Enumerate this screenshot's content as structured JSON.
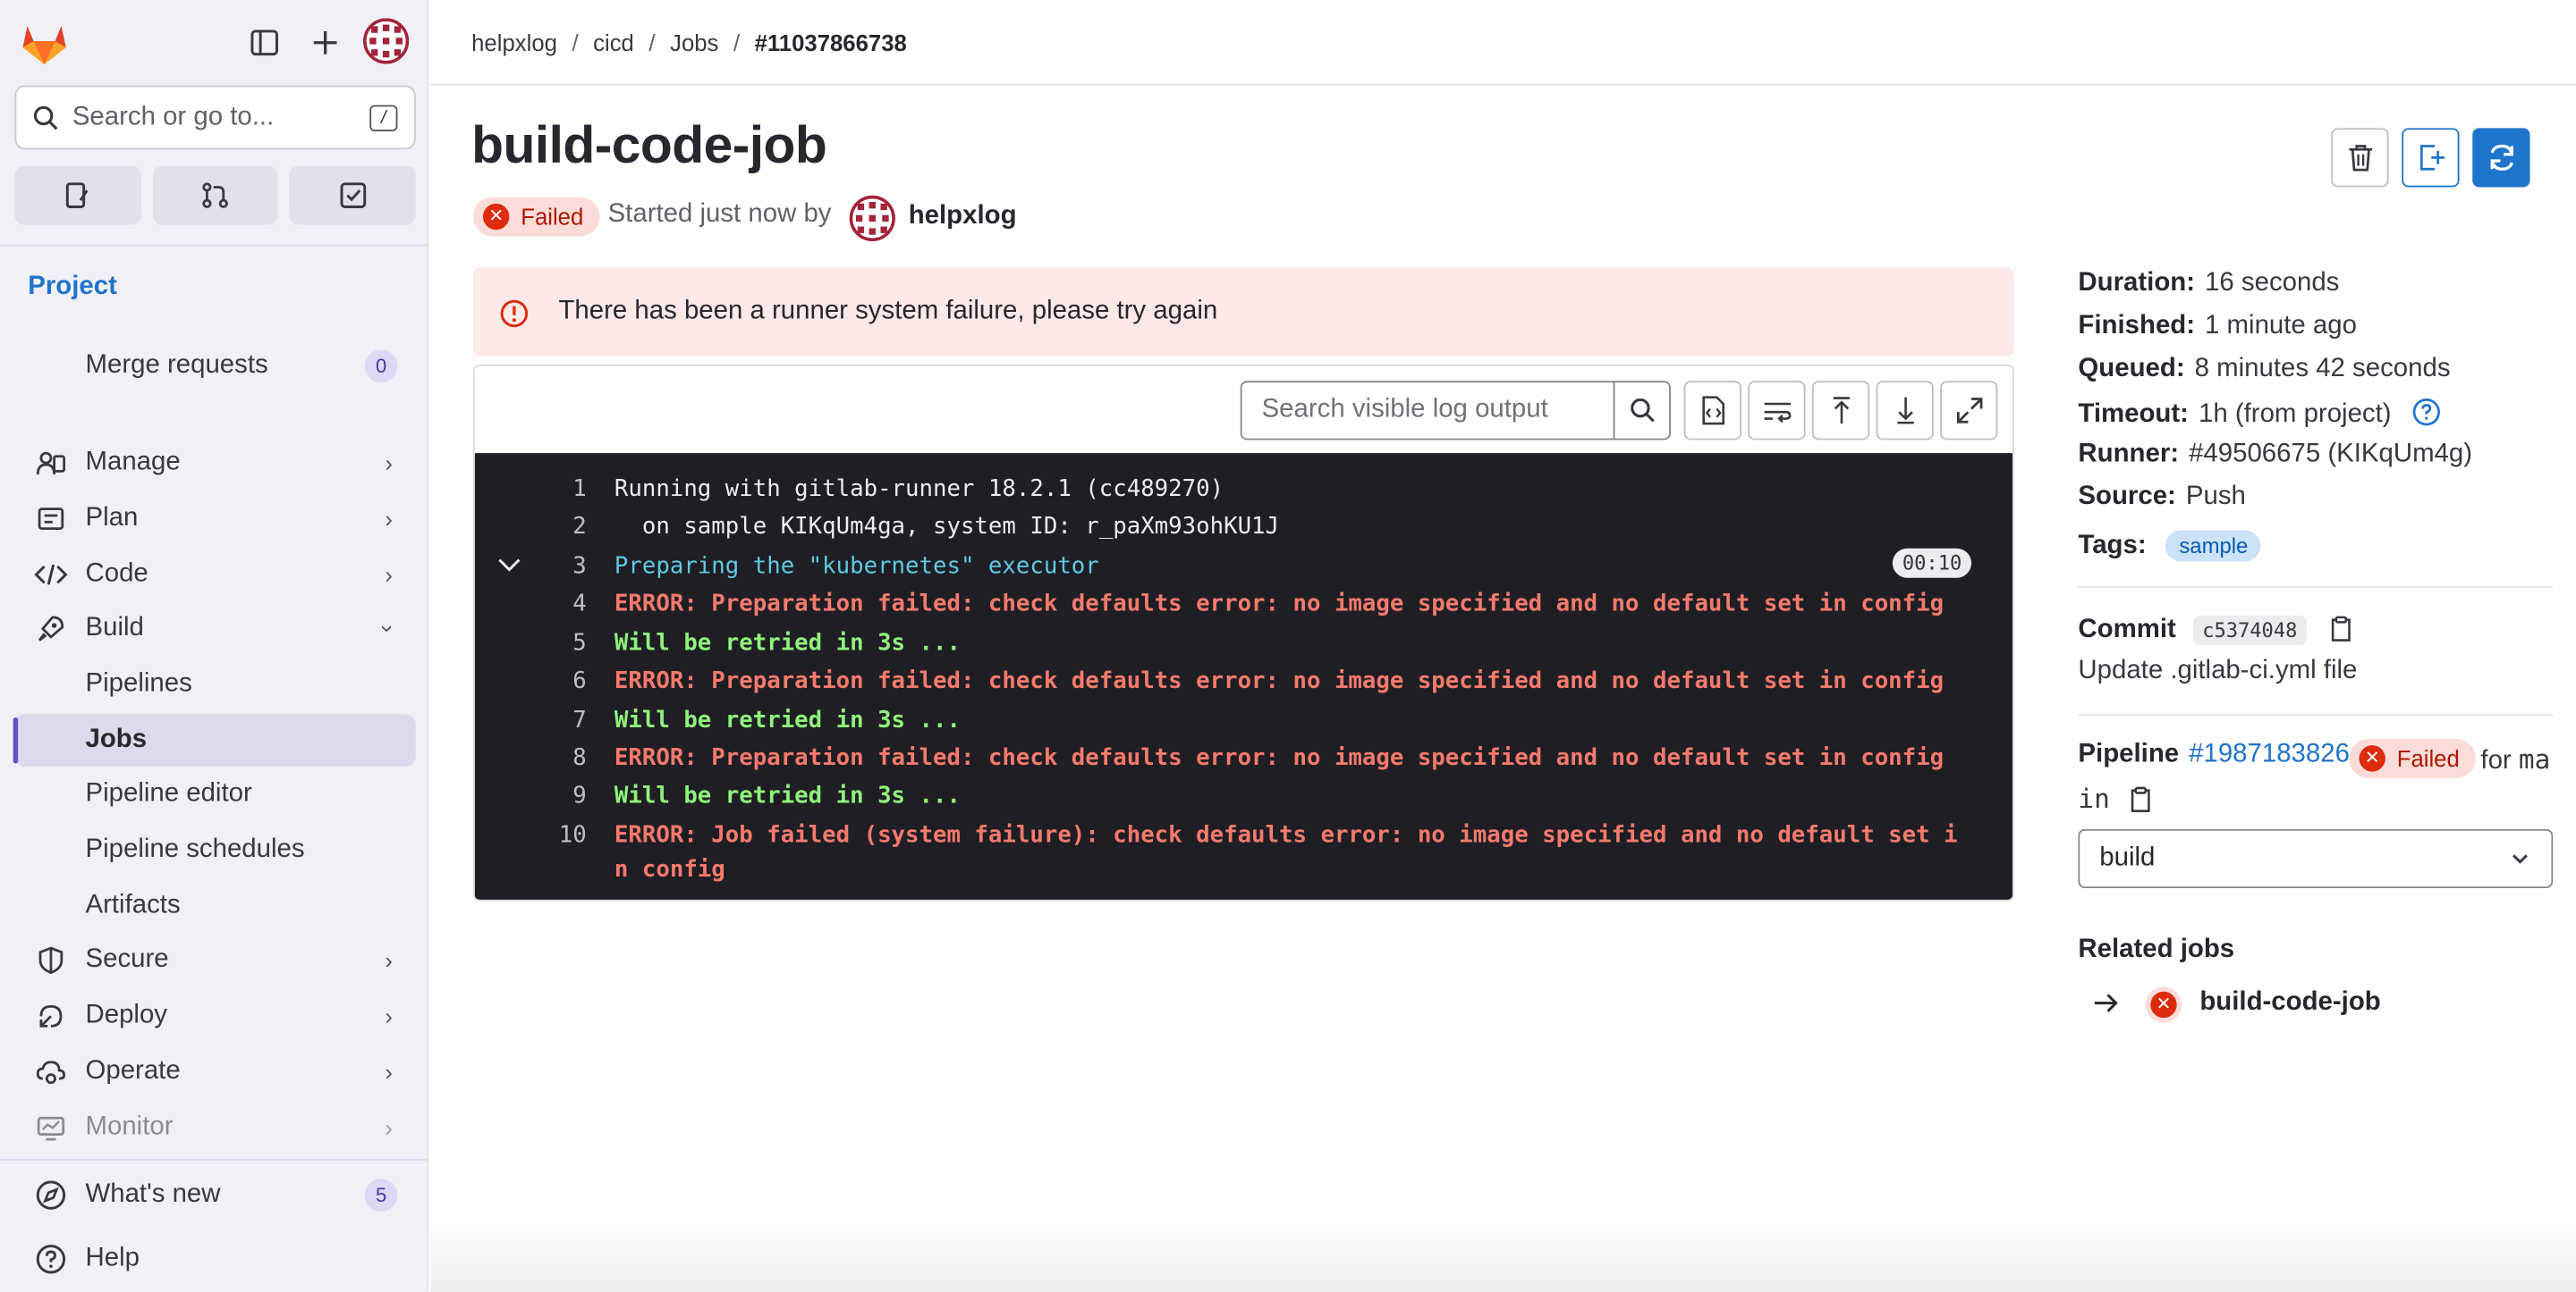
{
  "sidebar": {
    "search_placeholder": "Search or go to...",
    "search_shortcut": "/",
    "section_label": "Project",
    "merge_requests": {
      "label": "Merge requests",
      "count": "0"
    },
    "items": [
      {
        "label": "Manage"
      },
      {
        "label": "Plan"
      },
      {
        "label": "Code"
      },
      {
        "label": "Build"
      },
      {
        "label": "Pipelines"
      },
      {
        "label": "Jobs"
      },
      {
        "label": "Pipeline editor"
      },
      {
        "label": "Pipeline schedules"
      },
      {
        "label": "Artifacts"
      },
      {
        "label": "Secure"
      },
      {
        "label": "Deploy"
      },
      {
        "label": "Operate"
      },
      {
        "label": "Monitor"
      }
    ],
    "whats_new": {
      "label": "What's new",
      "count": "5"
    },
    "help": "Help"
  },
  "breadcrumb": [
    "helpxlog",
    "cicd",
    "Jobs",
    "#11037866738"
  ],
  "job": {
    "title": "build-code-job",
    "status": "Failed",
    "started_text": "Started just now by",
    "user": "helpxlog"
  },
  "alert": "There has been a runner system failure, please try again",
  "log": {
    "search_placeholder": "Search visible log output",
    "section_duration": "00:10",
    "lines": [
      {
        "n": "1",
        "text": "Running with gitlab-runner 18.2.1 (cc489270)"
      },
      {
        "n": "2",
        "text": "  on sample KIKqUm4ga, system ID: r_paXm93ohKU1J"
      },
      {
        "n": "3",
        "text": "Preparing the \"kubernetes\" executor"
      },
      {
        "n": "4",
        "text": "ERROR: Preparation failed: check defaults error: no image specified and no default set in config"
      },
      {
        "n": "5",
        "text": "Will be retried in 3s ..."
      },
      {
        "n": "6",
        "text": "ERROR: Preparation failed: check defaults error: no image specified and no default set in config"
      },
      {
        "n": "7",
        "text": "Will be retried in 3s ..."
      },
      {
        "n": "8",
        "text": "ERROR: Preparation failed: check defaults error: no image specified and no default set in config"
      },
      {
        "n": "9",
        "text": "Will be retried in 3s ..."
      },
      {
        "n": "10",
        "text": "ERROR: Job failed (system failure): check defaults error: no image specified and no default set i"
      },
      {
        "n": "",
        "text": "n config"
      }
    ]
  },
  "details": {
    "duration_label": "Duration:",
    "duration": "16 seconds",
    "finished_label": "Finished:",
    "finished": "1 minute ago",
    "queued_label": "Queued:",
    "queued": "8 minutes 42 seconds",
    "timeout_label": "Timeout:",
    "timeout": "1h (from project)",
    "runner_label": "Runner:",
    "runner": "#49506675 (KIKqUm4g)",
    "source_label": "Source:",
    "source": "Push",
    "tags_label": "Tags:",
    "tag": "sample",
    "commit_label": "Commit",
    "commit_hash": "c5374048",
    "commit_message": "Update .gitlab-ci.yml file",
    "pipeline_label": "Pipeline",
    "pipeline_id": "#1987183826",
    "pipeline_status": "Failed",
    "pipeline_for": "for",
    "branch_part1": "ma",
    "branch_part2": "in",
    "stage": "build",
    "related_label": "Related jobs",
    "related_job": "build-code-job"
  },
  "colors": {
    "accent": "#1f75cb",
    "danger": "#dd2b0e",
    "sidebar_bg": "#f1f0f6",
    "log_bg": "#1f1e24"
  }
}
